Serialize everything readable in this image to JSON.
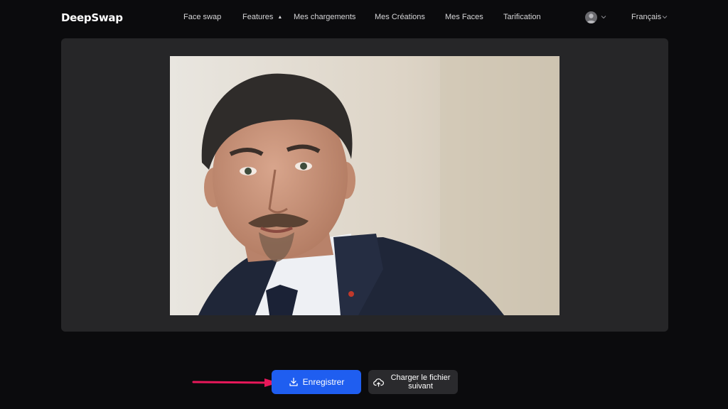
{
  "header": {
    "logo": "DeepSwap",
    "nav": [
      {
        "label": "Face swap"
      },
      {
        "label": "Features",
        "caret": "▲"
      },
      {
        "label": "Mes chargements"
      },
      {
        "label": "Mes Créations"
      },
      {
        "label": "Mes Faces"
      },
      {
        "label": "Tarification"
      }
    ],
    "language": "Français"
  },
  "actions": {
    "save_label": "Enregistrer",
    "next_label": "Charger le fichier suivant"
  },
  "colors": {
    "primary": "#1f5ef0",
    "annotation_arrow": "#e8185a",
    "background": "#0b0b0d",
    "panel": "#262628"
  },
  "icons": {
    "save": "download-icon",
    "next": "cloud-upload-icon"
  }
}
